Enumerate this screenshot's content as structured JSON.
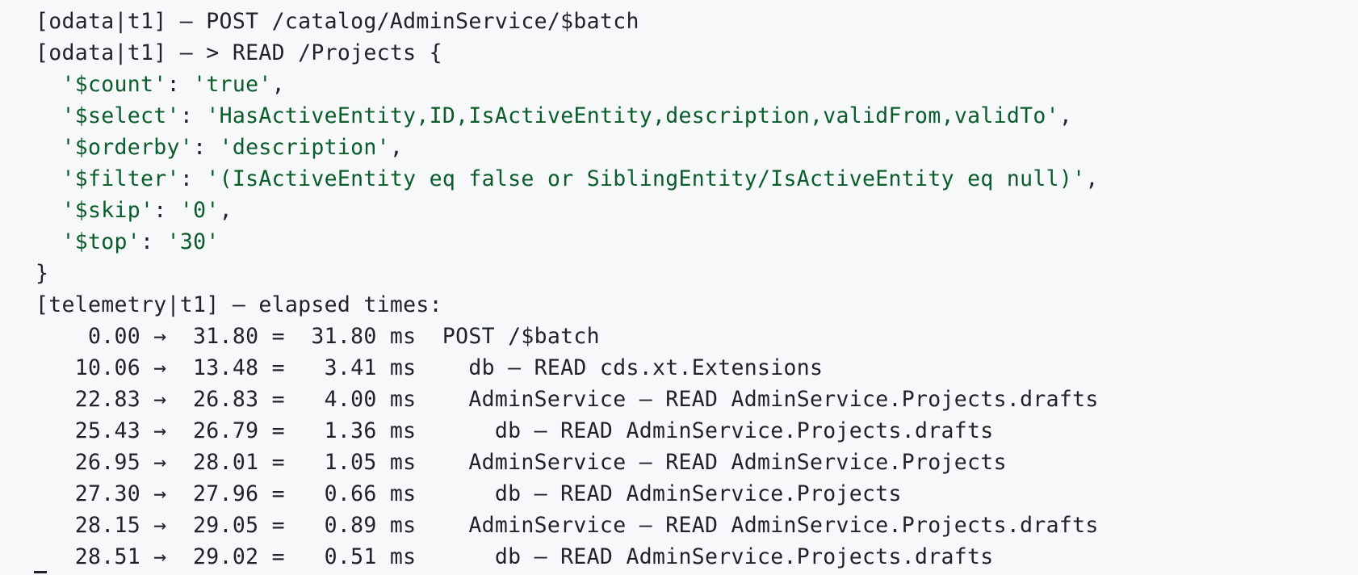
{
  "log": {
    "batch_request": "[odata|t1] – POST /catalog/AdminService/$batch",
    "read_request": "[odata|t1] – > READ /Projects {",
    "query_params": [
      {
        "key": "'$count'",
        "value": "'true'",
        "trail": ","
      },
      {
        "key": "'$select'",
        "value": "'HasActiveEntity,ID,IsActiveEntity,description,validFrom,validTo'",
        "trail": ","
      },
      {
        "key": "'$orderby'",
        "value": "'description'",
        "trail": ","
      },
      {
        "key": "'$filter'",
        "value": "'(IsActiveEntity eq false or SiblingEntity/IsActiveEntity eq null)'",
        "trail": ","
      },
      {
        "key": "'$skip'",
        "value": "'0'",
        "trail": ","
      },
      {
        "key": "'$top'",
        "value": "'30'",
        "trail": ""
      }
    ],
    "close_brace": "}",
    "telemetry_header": "[telemetry|t1] – elapsed times:",
    "timings": [
      "    0.00 →  31.80 =  31.80 ms  POST /$batch",
      "   10.06 →  13.48 =   3.41 ms    db – READ cds.xt.Extensions",
      "   22.83 →  26.83 =   4.00 ms    AdminService – READ AdminService.Projects.drafts",
      "   25.43 →  26.79 =   1.36 ms      db – READ AdminService.Projects.drafts",
      "   26.95 →  28.01 =   1.05 ms    AdminService – READ AdminService.Projects",
      "   27.30 →  27.96 =   0.66 ms      db – READ AdminService.Projects",
      "   28.15 →  29.05 =   0.89 ms    AdminService – READ AdminService.Projects.drafts",
      "   28.51 →  29.02 =   0.51 ms      db – READ AdminService.Projects.drafts"
    ]
  },
  "colors": {
    "background": "#f6f8fa",
    "text": "#1f2328",
    "string": "#0a5c2a"
  }
}
